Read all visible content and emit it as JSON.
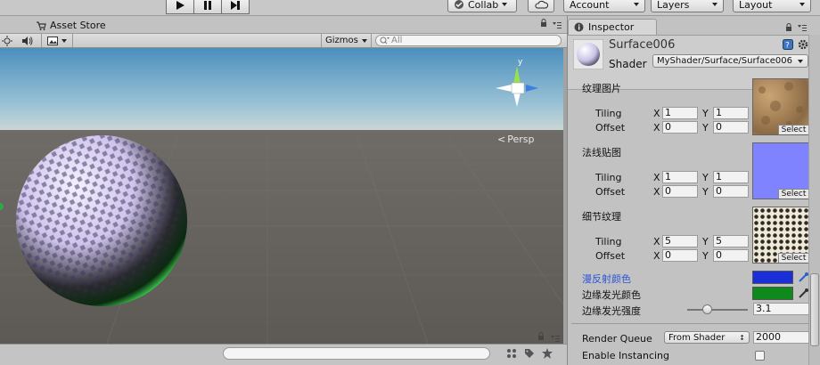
{
  "toolbar": {
    "collab": "Collab",
    "account": "Account",
    "layers": "Layers",
    "layout": "Layout"
  },
  "scene": {
    "tab": "Asset Store",
    "gizmos": "Gizmos",
    "search_placeholder": "All",
    "persp": "Persp",
    "gizmo_axis_y": "y"
  },
  "inspector": {
    "tab": "Inspector",
    "material_name": "Surface006",
    "shader_label": "Shader",
    "shader_value": "MyShader/Surface/Surface006",
    "props": [
      {
        "label": "纹理图片",
        "tiling_x": "1",
        "tiling_y": "1",
        "offset_x": "0",
        "offset_y": "0"
      },
      {
        "label": "法线贴图",
        "tiling_x": "1",
        "tiling_y": "1",
        "offset_x": "0",
        "offset_y": "0"
      },
      {
        "label": "细节纹理",
        "tiling_x": "5",
        "tiling_y": "5",
        "offset_x": "0",
        "offset_y": "0"
      }
    ],
    "tiling_label": "Tiling",
    "offset_label": "Offset",
    "x_label": "X",
    "y_label": "Y",
    "select_label": "Select",
    "diffuse_color_label": "漫反射颜色",
    "diffuse_color": "#1a2fd8",
    "rim_color_label": "边缘发光颜色",
    "rim_color": "#0e8a1c",
    "rim_strength_label": "边缘发光强度",
    "rim_strength_value": "3.1",
    "render_queue_label": "Render Queue",
    "render_queue_mode": "From Shader",
    "render_queue_value": "2000",
    "enable_instancing_label": "Enable Instancing"
  }
}
